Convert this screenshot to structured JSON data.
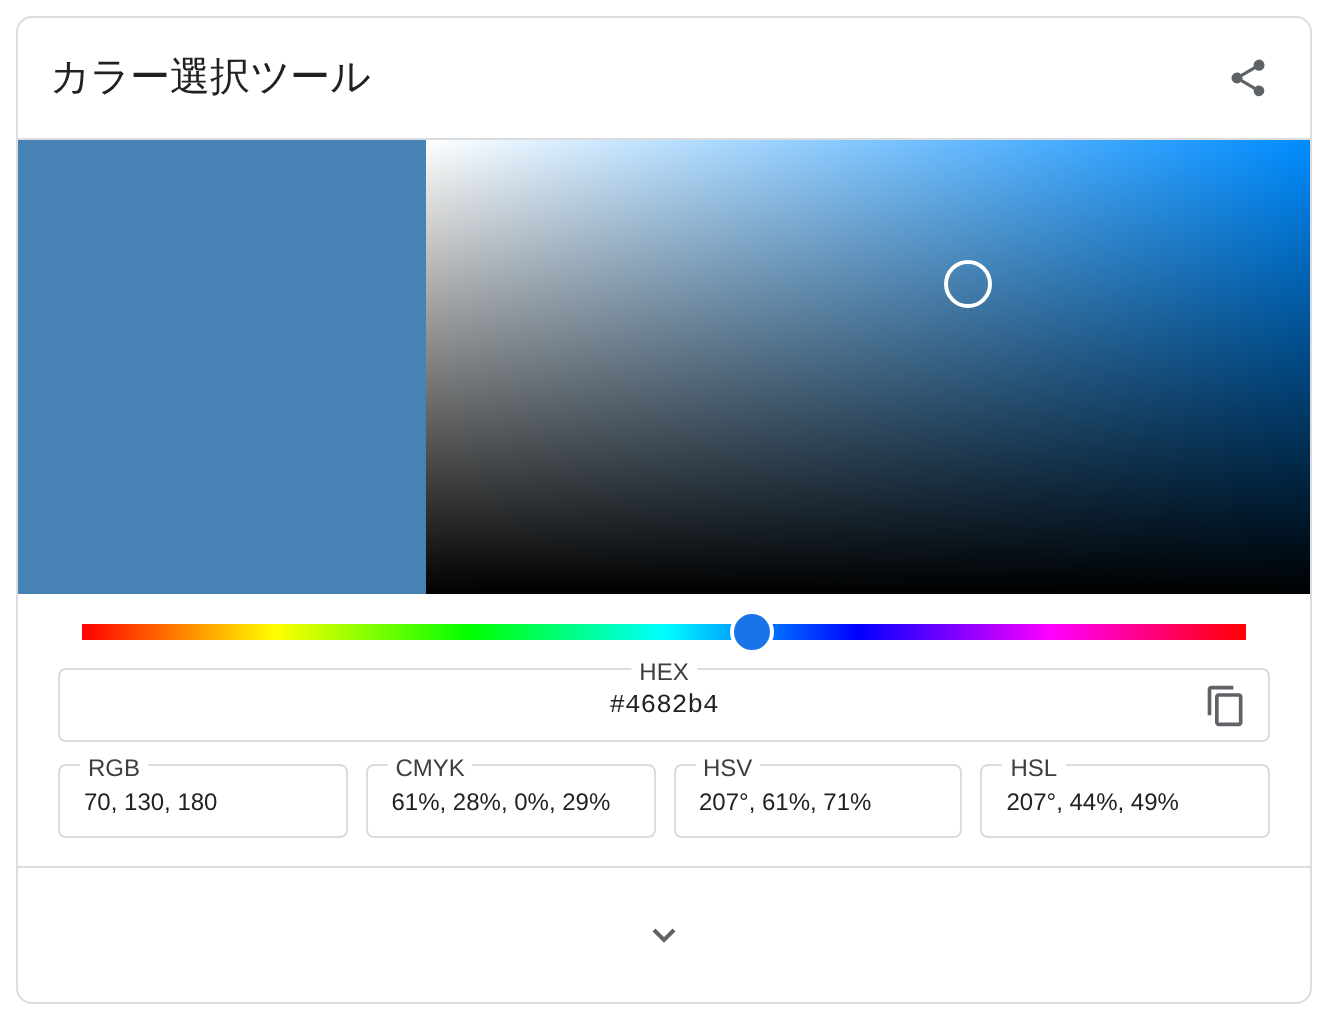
{
  "title": "カラー選択ツール",
  "swatch": {
    "color": "#4682b4"
  },
  "hue_slider": {
    "level": 0.575
  },
  "hex": {
    "label": "HEX",
    "value": "#4682b4"
  },
  "fields": [
    {
      "label": "RGB",
      "value": "70, 130, 180"
    },
    {
      "label": "CMYK",
      "value": "61%, 28%, 0%, 29%"
    },
    {
      "label": "HSV",
      "value": "207°, 61%, 71%"
    },
    {
      "label": "HSL",
      "value": "207°, 44%, 49%"
    }
  ]
}
